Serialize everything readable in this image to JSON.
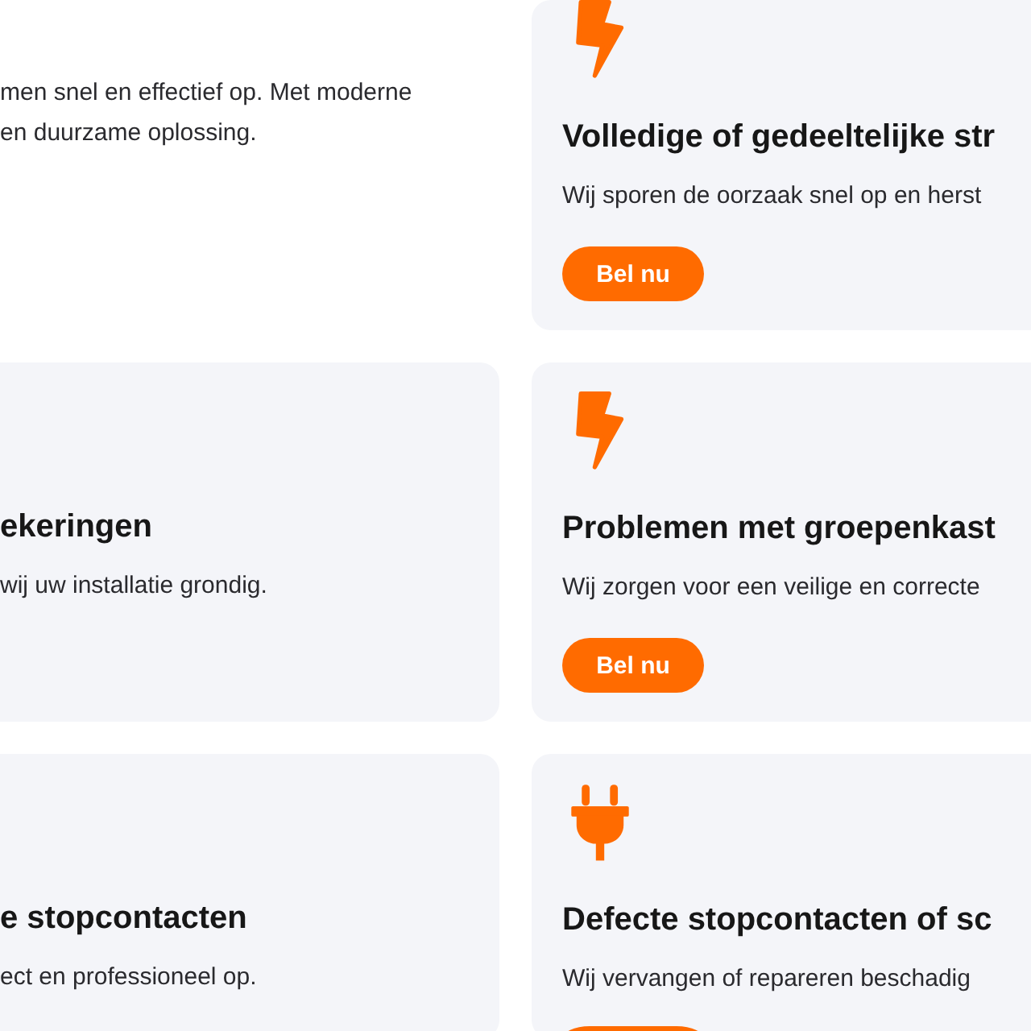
{
  "cards": [
    {
      "kind": "plain",
      "lines": [
        "men snel en effectief op. Met moderne",
        "en duurzame oplossing."
      ]
    },
    {
      "kind": "bolt",
      "title": "Volledige of gedeeltelijke str",
      "lines": [
        "Wij sporen de oorzaak snel op en herst"
      ],
      "button": {
        "label": "Bel nu",
        "cut_off": false
      }
    },
    {
      "kind": "panel",
      "title": "ekeringen",
      "lines": [
        "wij uw installatie grondig."
      ]
    },
    {
      "kind": "bolt",
      "title": "Problemen met groepenkast",
      "lines": [
        "Wij zorgen voor een veilige en correcte"
      ],
      "button": {
        "label": "Bel nu",
        "cut_off": false
      }
    },
    {
      "kind": "panel",
      "title": "e stopcontacten",
      "lines": [
        "ect en professioneel op."
      ]
    },
    {
      "kind": "plug",
      "title": "Defecte stopcontacten of sc",
      "lines": [
        "Wij vervangen of repareren beschadig"
      ],
      "button": {
        "cut_off": true
      }
    }
  ]
}
